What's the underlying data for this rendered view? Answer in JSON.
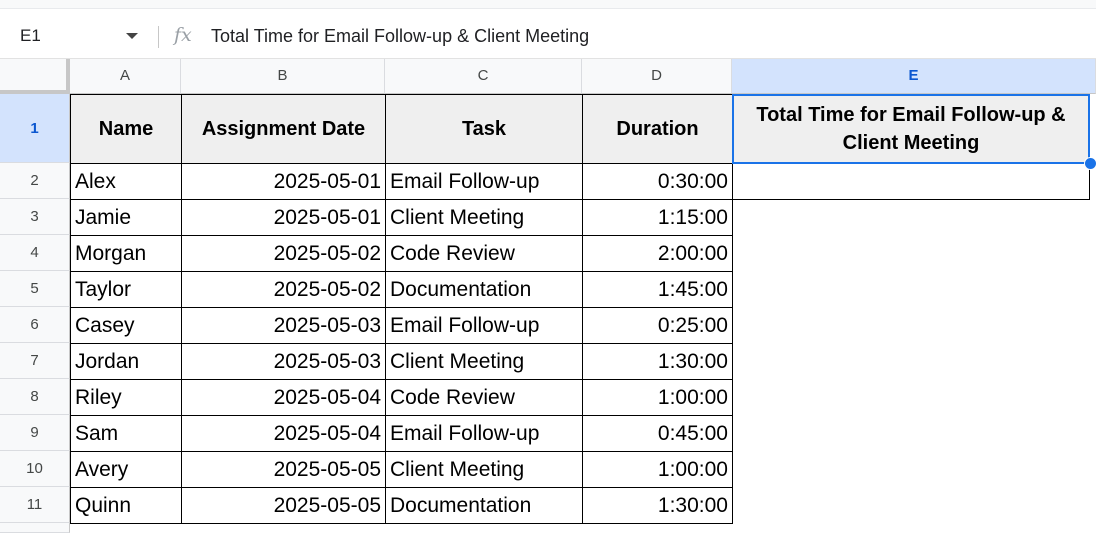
{
  "formula_bar": {
    "name_box": "E1",
    "fx_symbol": "fx",
    "content": "Total Time for Email Follow-up & Client Meeting"
  },
  "columns": [
    "A",
    "B",
    "C",
    "D",
    "E"
  ],
  "rows": [
    "1",
    "2",
    "3",
    "4",
    "5",
    "6",
    "7",
    "8",
    "9",
    "10",
    "11"
  ],
  "headers": {
    "name": "Name",
    "date": "Assignment Date",
    "task": "Task",
    "duration": "Duration",
    "total": "Total Time for Email Follow-up & Client Meeting"
  },
  "data": [
    {
      "name": "Alex",
      "date": "2025-05-01",
      "task": "Email Follow-up",
      "duration": "0:30:00"
    },
    {
      "name": "Jamie",
      "date": "2025-05-01",
      "task": "Client Meeting",
      "duration": "1:15:00"
    },
    {
      "name": "Morgan",
      "date": "2025-05-02",
      "task": "Code Review",
      "duration": "2:00:00"
    },
    {
      "name": "Taylor",
      "date": "2025-05-02",
      "task": "Documentation",
      "duration": "1:45:00"
    },
    {
      "name": "Casey",
      "date": "2025-05-03",
      "task": "Email Follow-up",
      "duration": "0:25:00"
    },
    {
      "name": "Jordan",
      "date": "2025-05-03",
      "task": "Client Meeting",
      "duration": "1:30:00"
    },
    {
      "name": "Riley",
      "date": "2025-05-04",
      "task": "Code Review",
      "duration": "1:00:00"
    },
    {
      "name": "Sam",
      "date": "2025-05-04",
      "task": "Email Follow-up",
      "duration": "0:45:00"
    },
    {
      "name": "Avery",
      "date": "2025-05-05",
      "task": "Client Meeting",
      "duration": "1:00:00"
    },
    {
      "name": "Quinn",
      "date": "2025-05-05",
      "task": "Documentation",
      "duration": "1:30:00"
    }
  ],
  "selected_cell": "E1",
  "colors": {
    "selection": "#1a73e8",
    "header_fill": "#efefef",
    "selected_header": "#d3e3fd"
  }
}
